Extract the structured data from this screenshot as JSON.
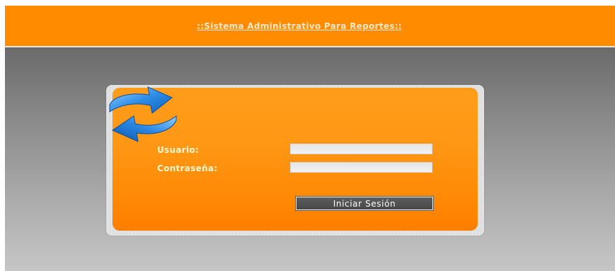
{
  "header": {
    "title": "::Sistema Administrativo Para Reportes::"
  },
  "login": {
    "user_label": "Usuario:",
    "password_label": "Contraseña:",
    "user_value": "",
    "password_value": "",
    "submit_label": "Iniciar Sesión",
    "icon": "refresh-arrows-icon"
  },
  "colors": {
    "header_bg": "#ff8c00",
    "panel_orange": "#ff9714",
    "button_bg": "#4f4f4f"
  }
}
